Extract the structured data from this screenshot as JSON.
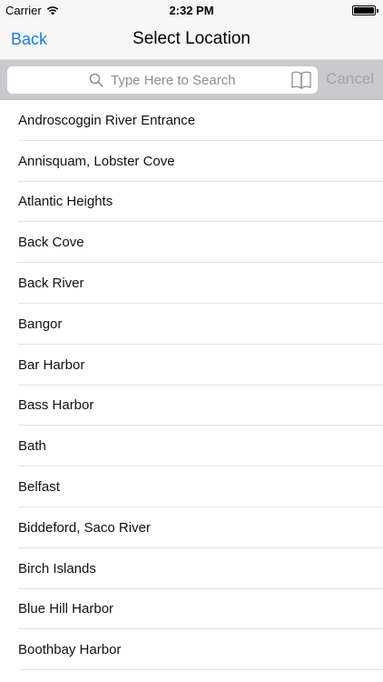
{
  "status_bar": {
    "carrier": "Carrier",
    "time": "2:32 PM"
  },
  "nav": {
    "back_label": "Back",
    "title": "Select Location"
  },
  "search": {
    "placeholder": "Type Here to Search",
    "value": "",
    "cancel_label": "Cancel"
  },
  "locations": [
    "Androscoggin River Entrance",
    "Annisquam, Lobster Cove",
    "Atlantic Heights",
    "Back Cove",
    "Back River",
    "Bangor",
    "Bar Harbor",
    "Bass Harbor",
    "Bath",
    "Belfast",
    "Biddeford, Saco River",
    "Birch Islands",
    "Blue Hill Harbor",
    "Boothbay Harbor"
  ],
  "colors": {
    "accent": "#1a7cf0",
    "cancel_disabled": "#a3a3a8",
    "search_bar_bg": "#c9c9ce"
  },
  "icons": {
    "wifi": "wifi-icon",
    "battery": "battery-icon",
    "search": "search-icon",
    "bookmark": "book-icon"
  }
}
